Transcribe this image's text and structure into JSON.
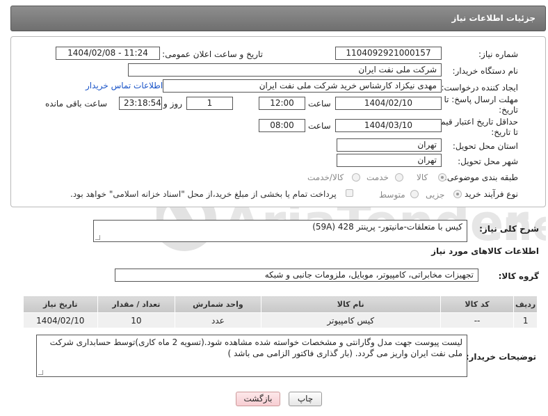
{
  "header": {
    "title": "جزئیات اطلاعات نیاز"
  },
  "form": {
    "need_number_label": "شماره نیاز:",
    "need_number": "1104092921000157",
    "announce_label": "تاریخ و ساعت اعلان عمومی:",
    "announce_value": "1404/02/08 - 11:24",
    "buyer_org_label": "نام دستگاه خریدار:",
    "buyer_org": "شرکت ملی نفت ایران",
    "creator_label": "ایجاد کننده درخواست:",
    "creator": "مهدی نیکزاد کارشناس خرید شرکت ملی نفت ایران",
    "contact_link": "اطلاعات تماس خریدار",
    "deadline_label_1": "مهلت ارسال پاسخ: تا",
    "deadline_label_2": "تاریخ:",
    "deadline_date": "1404/02/10",
    "time_label": "ساعت",
    "deadline_time": "12:00",
    "days_value": "1",
    "days_label": "روز و",
    "remaining_time": "23:18:54",
    "remaining_label": "ساعت باقی مانده",
    "validity_label_1": "حداقل تاریخ اعتبار قیمت:",
    "validity_label_2": "تا تاریخ:",
    "validity_date": "1404/03/10",
    "validity_time": "08:00",
    "province_label": "استان محل تحویل:",
    "province": "تهران",
    "city_label": "شهر محل تحویل:",
    "city": "تهران",
    "category_label": "طبقه بندی موضوعی:",
    "category_options": [
      "کالا",
      "خدمت",
      "کالا/خدمت"
    ],
    "category_selected": "کالا",
    "process_label": "نوع فرآیند خرید :",
    "process_options": [
      "جزیی",
      "متوسط"
    ],
    "process_selected": "جزیی",
    "payment_note": "پرداخت تمام یا بخشی از مبلغ خرید،از محل \"اسناد خزانه اسلامی\" خواهد بود."
  },
  "summary": {
    "label": "شرح کلی نیاز:",
    "value": "کیس با متعلقات-مانیتور-   پرینتر 428 (59A)"
  },
  "goods_section": {
    "title": "اطلاعات کالاهای مورد نیاز",
    "group_label": "گروه کالا:",
    "group_value": "تجهیزات مخابراتی، کامپیوتر، موبایل، ملزومات جانبی و شبکه"
  },
  "table": {
    "headers": [
      "ردیف",
      "کد کالا",
      "نام کالا",
      "واحد شمارش",
      "تعداد / مقدار",
      "تاریخ نیاز"
    ],
    "rows": [
      [
        "1",
        "--",
        "کیس کامپیوتر",
        "عدد",
        "10",
        "1404/02/10"
      ]
    ]
  },
  "notes": {
    "label": "توضیحات خریدار:",
    "value": "لیست پیوست جهت مدل وگارانتی و مشخصات خواسته شده مشاهده شود.(تسویه 2 ماه کاری)توسط حسابداری شرکت ملی نفت ایران واریز می گردد. (بار گذاری فاکتور الزامی می باشد )"
  },
  "buttons": {
    "print": "چاپ",
    "back": "بازگشت"
  },
  "watermark": {
    "text": "AriaTender.net"
  },
  "colors": {
    "title_bar": "#7d7d7d",
    "link": "#1a54c8",
    "back_button": "#f7cdd2"
  }
}
